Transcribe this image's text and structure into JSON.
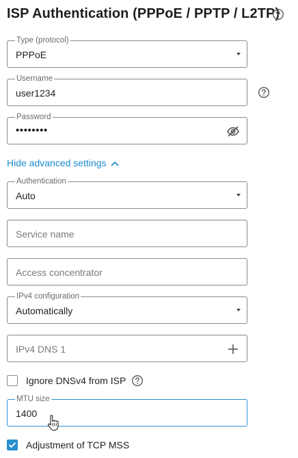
{
  "page": {
    "title": "ISP Authentication (PPPoE / PPTP / L2TP)"
  },
  "fields": {
    "type": {
      "label": "Type (protocol)",
      "value": "PPPoE"
    },
    "username": {
      "label": "Username",
      "value": "user1234"
    },
    "password": {
      "label": "Password",
      "value": "••••••••"
    },
    "authentication": {
      "label": "Authentication",
      "value": "Auto"
    },
    "service_name": {
      "placeholder": "Service name"
    },
    "access_concentrator": {
      "placeholder": "Access concentrator"
    },
    "ipv4_config": {
      "label": "IPv4 configuration",
      "value": "Automatically"
    },
    "ipv4_dns1": {
      "placeholder": "IPv4 DNS 1"
    },
    "mtu": {
      "label": "MTU size",
      "value": "1400"
    }
  },
  "advanced": {
    "toggle_label": "Hide advanced settings"
  },
  "checkboxes": {
    "ignore_dns": {
      "label": "Ignore DNSv4 from ISP",
      "checked": false
    },
    "tcp_mss": {
      "label": "Adjustment of TCP MSS",
      "checked": true
    }
  },
  "colors": {
    "accent": "#2a8fd0",
    "border": "#8a8a8a",
    "link": "#1a8bd0"
  },
  "icons": [
    "help-icon",
    "eye-off-icon",
    "plus-icon",
    "chevron-up-icon",
    "caret-down-icon",
    "checkmark-icon",
    "hand-cursor-icon"
  ]
}
